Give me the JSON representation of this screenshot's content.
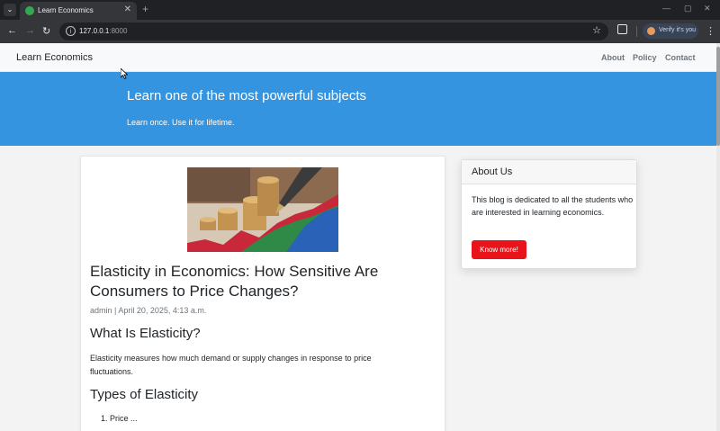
{
  "browser": {
    "tab_title": "Learn Economics",
    "tab_close": "✕",
    "new_tab": "+",
    "url_host": "127.0.0.1",
    "url_port": ":8000",
    "profile_label": "Verify it's you",
    "icons": [
      "back-arrow-icon",
      "forward-arrow-icon",
      "reload-icon",
      "site-info-icon",
      "bookmark-star-icon",
      "extensions-icon",
      "kebab-menu-icon"
    ]
  },
  "site": {
    "brand": "Learn Economics",
    "nav": [
      {
        "label": "About"
      },
      {
        "label": "Policy"
      },
      {
        "label": "Contact"
      }
    ]
  },
  "hero": {
    "title": "Learn one of the most powerful subjects",
    "subtitle": "Learn once. Use it for lifetime."
  },
  "post": {
    "title": "Elasticity in Economics: How Sensitive Are Consumers to Price Changes?",
    "meta": "admin | April 20, 2025, 4:13 a.m.",
    "section1_heading": "What Is Elasticity?",
    "section1_text": "Elasticity measures how much demand or supply changes in response to price fluctuations.",
    "section2_heading": "Types of Elasticity",
    "list_item_1": "1. Price ..."
  },
  "sidebar": {
    "title": "About Us",
    "text": "This blog is dedicated to all the students who are interested in learning economics.",
    "button_label": "Know more!",
    "button_color": "#e8141a"
  },
  "colors": {
    "hero_bg": "#3494e0",
    "navbar_bg": "#f8f9fa"
  }
}
